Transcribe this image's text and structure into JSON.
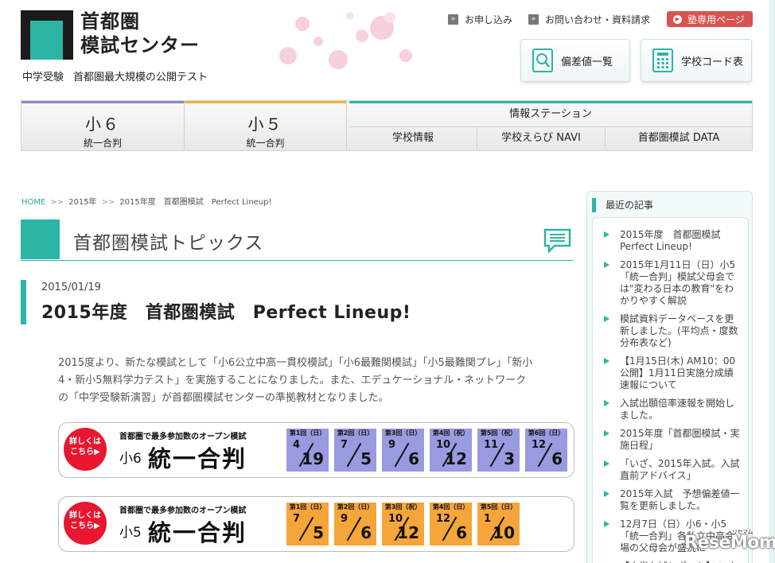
{
  "header": {
    "logo_line1": "首都圏",
    "logo_line2": "模試センター",
    "tagline_1": "中学受験",
    "tagline_2": "首都圏最大規模の公開テスト",
    "links": [
      {
        "label": "お申し込み"
      },
      {
        "label": "お問い合わせ・資料請求"
      }
    ],
    "juku_label": "塾専用ページ",
    "btn_hensachi": "偏差値一覧",
    "btn_school_code": "学校コード表"
  },
  "nav": {
    "tab1_title": "小６",
    "tab1_sub": "統一合判",
    "tab2_title": "小５",
    "tab2_sub": "統一合判",
    "info_title": "情報ステーション",
    "info_subs": [
      "学校情報",
      "学校えらび NAVI",
      "首都圏模試 DATA"
    ],
    "colors": {
      "tab1": "#8b8bc8",
      "tab2": "#f0b040",
      "info": "#2bb5a5"
    }
  },
  "breadcrumb": {
    "home": "HOME",
    "sep": ">>",
    "c2": "2015年",
    "c3": "2015年度　首都圏模試　Perfect Lineup!"
  },
  "section_title": "首都圏模試トピックス",
  "article": {
    "date": "2015/01/19",
    "title": "2015年度　首都圏模試　Perfect Lineup!",
    "body": "2015度より、新たな模試として「小6公立中高一貫校模試」「小6最難関模試」「小5最難関プレ」「新小4・新小5無料学力テスト」を実施することになりました。また、エデュケーショナル・ネットワークの「中学受験新演習」が首都圏模試センターの準拠教材となりました。"
  },
  "banners": [
    {
      "circle": "詳しくは\nこちら▶",
      "sub": "首都圏で最多参加数のオープン模試",
      "grade": "小6",
      "main": "統一合判",
      "color": "#9a9ae0",
      "dates": [
        {
          "lb": "第1回（日）",
          "m": "4",
          "d": "19"
        },
        {
          "lb": "第2回（日）",
          "m": "7",
          "d": "5"
        },
        {
          "lb": "第3回（日）",
          "m": "9",
          "d": "6"
        },
        {
          "lb": "第4回（祝）",
          "m": "10",
          "d": "12"
        },
        {
          "lb": "第5回（祝）",
          "m": "11",
          "d": "3"
        },
        {
          "lb": "第6回（日）",
          "m": "12",
          "d": "6"
        }
      ]
    },
    {
      "circle": "詳しくは\nこちら▶",
      "sub": "首都圏で最多参加数のオープン模試",
      "grade": "小5",
      "main": "統一合判",
      "color": "#f5a53a",
      "dates": [
        {
          "lb": "第1回（日）",
          "m": "7",
          "d": "5"
        },
        {
          "lb": "第2回（日）",
          "m": "9",
          "d": "6"
        },
        {
          "lb": "第3回（祝）",
          "m": "10",
          "d": "12"
        },
        {
          "lb": "第4回（日）",
          "m": "12",
          "d": "6"
        },
        {
          "lb": "第5回（日）",
          "m": "1",
          "d": "10"
        }
      ]
    }
  ],
  "sidebar": {
    "title": "最近の記事",
    "items": [
      "2015年度　首都圏模試　Perfect Lineup!",
      "2015年1月11日（日）小5「統一合判」模試父母会では\"変わる日本の教育\"をわかりやすく解説",
      "模試資料データベースを更新しました。(平均点・度数分布表など)",
      "【1月15日(木) AM10：00公開】1月11日実施分成績速報について",
      "入試出願倍率速報を開始しました。",
      "2015年度「首都圏模試・実施日程」",
      "「いざ、2015年入試。入試直前アドバイス」",
      "2015年入試　予想偏差値一覧を更新しました。",
      "12月7日（日）小6・小5「統一合判」各私立中高会場の父母会が盛況に",
      "【中学入試レポート】 いよ"
    ]
  },
  "watermark": "ReseMom",
  "watermark_small": "リセマム"
}
